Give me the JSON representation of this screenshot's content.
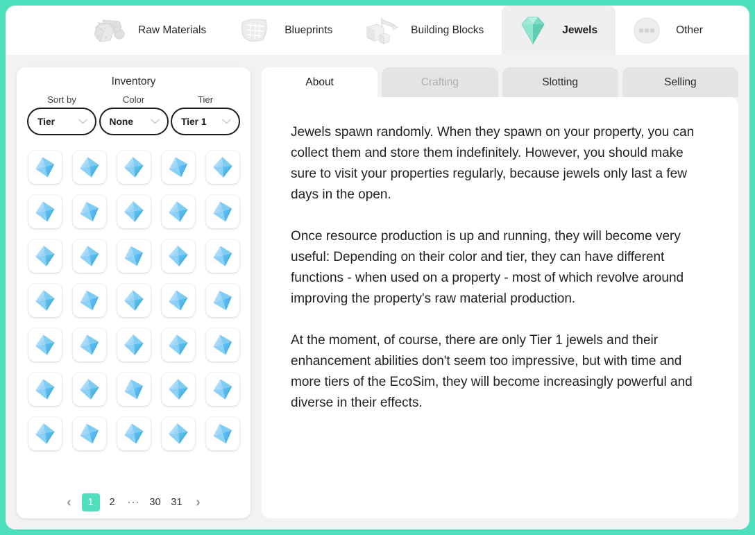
{
  "theme": {
    "frame_color": "#4ee0bd",
    "accent_color": "#4ee0bd",
    "page_bg": "#f2f2f2",
    "card_bg": "#ffffff",
    "jewel_light": "#a9d9f5",
    "jewel_mid": "#6cc6f0",
    "jewel_dark": "#3ea9e0"
  },
  "topnav": {
    "tabs": [
      {
        "label": "Raw Materials",
        "icon": "rocks-icon",
        "active": false
      },
      {
        "label": "Blueprints",
        "icon": "blueprint-icon",
        "active": false
      },
      {
        "label": "Building Blocks",
        "icon": "crane-icon",
        "active": false
      },
      {
        "label": "Jewels",
        "icon": "jewel-icon",
        "active": true
      },
      {
        "label": "Other",
        "icon": "ellipsis-circle-icon",
        "active": false
      }
    ]
  },
  "inventory": {
    "title": "Inventory",
    "filters": [
      {
        "label": "Sort by",
        "value": "Tier",
        "name": "sort-by-select"
      },
      {
        "label": "Color",
        "value": "None",
        "name": "color-select"
      },
      {
        "label": "Tier",
        "value": "Tier 1",
        "name": "tier-select"
      }
    ],
    "items": [
      {
        "name": "jewel-item",
        "rotation": -14
      },
      {
        "name": "jewel-item",
        "rotation": -10
      },
      {
        "name": "jewel-item",
        "rotation": -6
      },
      {
        "name": "jewel-item",
        "rotation": -16
      },
      {
        "name": "jewel-item",
        "rotation": -3
      },
      {
        "name": "jewel-item",
        "rotation": -12
      },
      {
        "name": "jewel-item",
        "rotation": -18
      },
      {
        "name": "jewel-item",
        "rotation": -5
      },
      {
        "name": "jewel-item",
        "rotation": -9
      },
      {
        "name": "jewel-item",
        "rotation": -15
      },
      {
        "name": "jewel-item",
        "rotation": -7
      },
      {
        "name": "jewel-item",
        "rotation": -11
      },
      {
        "name": "jewel-item",
        "rotation": -17
      },
      {
        "name": "jewel-item",
        "rotation": -4
      },
      {
        "name": "jewel-item",
        "rotation": -13
      },
      {
        "name": "jewel-item",
        "rotation": -8
      },
      {
        "name": "jewel-item",
        "rotation": -16
      },
      {
        "name": "jewel-item",
        "rotation": -6
      },
      {
        "name": "jewel-item",
        "rotation": -12
      },
      {
        "name": "jewel-item",
        "rotation": -19
      },
      {
        "name": "jewel-item",
        "rotation": -10
      },
      {
        "name": "jewel-item",
        "rotation": -14
      },
      {
        "name": "jewel-item",
        "rotation": -5
      },
      {
        "name": "jewel-item",
        "rotation": -9
      },
      {
        "name": "jewel-item",
        "rotation": -15
      },
      {
        "name": "jewel-item",
        "rotation": -11
      },
      {
        "name": "jewel-item",
        "rotation": -7
      },
      {
        "name": "jewel-item",
        "rotation": -17
      },
      {
        "name": "jewel-item",
        "rotation": -3
      },
      {
        "name": "jewel-item",
        "rotation": -13
      },
      {
        "name": "jewel-item",
        "rotation": -8
      },
      {
        "name": "jewel-item",
        "rotation": -16
      },
      {
        "name": "jewel-item",
        "rotation": -12
      },
      {
        "name": "jewel-item",
        "rotation": -6
      },
      {
        "name": "jewel-item",
        "rotation": -18
      }
    ],
    "pagination": {
      "prev": "‹",
      "next": "›",
      "pages": [
        {
          "label": "1",
          "current": true,
          "dots": false
        },
        {
          "label": "2",
          "current": false,
          "dots": false
        },
        {
          "label": "···",
          "current": false,
          "dots": true
        },
        {
          "label": "30",
          "current": false,
          "dots": false
        },
        {
          "label": "31",
          "current": false,
          "dots": false
        }
      ]
    }
  },
  "detail": {
    "tabs": [
      {
        "label": "About",
        "active": true,
        "disabled": false
      },
      {
        "label": "Crafting",
        "active": false,
        "disabled": true
      },
      {
        "label": "Slotting",
        "active": false,
        "disabled": false
      },
      {
        "label": "Selling",
        "active": false,
        "disabled": false
      }
    ],
    "paragraphs": [
      "Jewels spawn randomly. When they spawn on your property, you can collect them and store them indefinitely. However, you should make sure to visit your properties regularly, because jewels only last a few days in the open.",
      "Once resource production is up and running, they will become very useful: Depending on their color and tier, they can have different functions - when used on a property - most of which revolve around improving the property's raw material production.",
      "At the moment, of course, there are only Tier 1 jewels and their enhancement abilities don't seem too impressive, but with time and more tiers of the EcoSim, they will become increasingly powerful and diverse in their effects."
    ]
  }
}
